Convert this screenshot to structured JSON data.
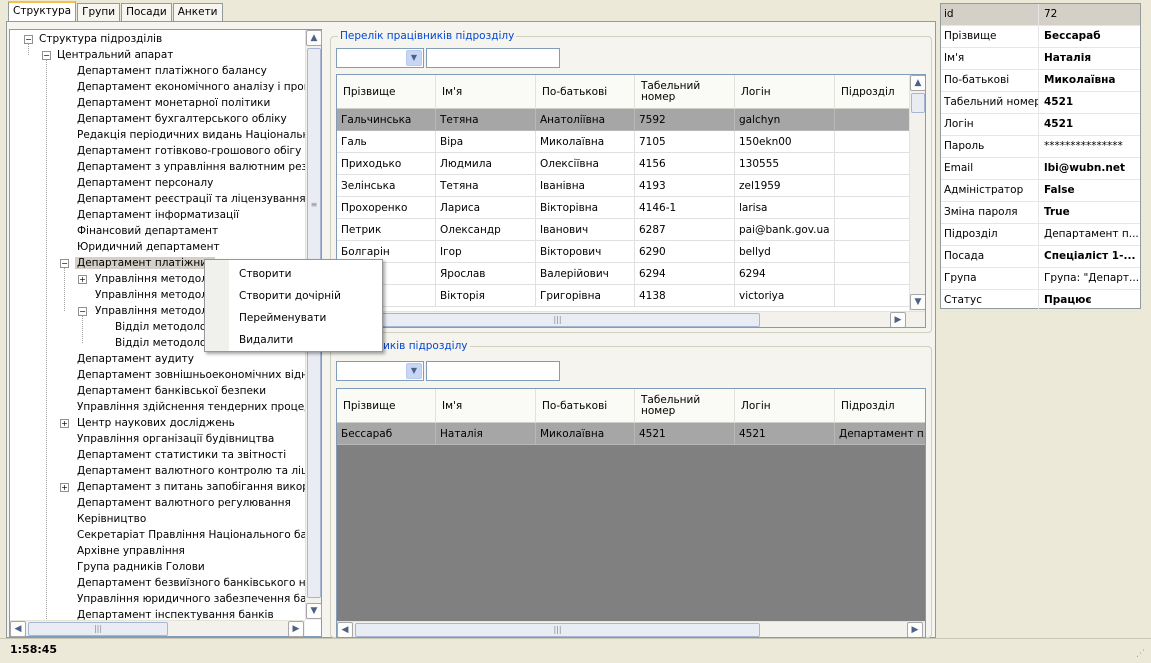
{
  "tabs": [
    "Структура",
    "Групи",
    "Посади",
    "Анкети"
  ],
  "tree": {
    "root": "Структура підрозділів",
    "items": [
      {
        "label": "Центральний апарат",
        "level": 1,
        "exp": "-"
      },
      {
        "label": "Департамент платіжного балансу",
        "level": 2
      },
      {
        "label": "Департамент економічного аналізу і прогноз",
        "level": 2
      },
      {
        "label": "Департамент монетарної політики",
        "level": 2
      },
      {
        "label": "Департамент бухгалтерського обліку",
        "level": 2
      },
      {
        "label": "Редакція періодичних видань Національного",
        "level": 2
      },
      {
        "label": "Департамент готівково-грошового обігу",
        "level": 2
      },
      {
        "label": "Департамент з управління валютним резерв",
        "level": 2
      },
      {
        "label": "Департамент персоналу",
        "level": 2
      },
      {
        "label": "Департамент реєстрації та ліцензування бан",
        "level": 2
      },
      {
        "label": "Департамент інформатизації",
        "level": 2
      },
      {
        "label": "Фінансовий департамент",
        "level": 2
      },
      {
        "label": "Юридичний департамент",
        "level": 2
      },
      {
        "label": "Департамент платіжних",
        "level": 2,
        "exp": "-",
        "sel": true
      },
      {
        "label": "Управління методол",
        "level": 3,
        "exp": "+"
      },
      {
        "label": "Управління методол",
        "level": 3
      },
      {
        "label": "Управління методол",
        "level": 3,
        "exp": "-"
      },
      {
        "label": "Відділ методолог",
        "level": 4
      },
      {
        "label": "Відділ методолог",
        "level": 4
      },
      {
        "label": "Департамент аудиту",
        "level": 2
      },
      {
        "label": "Департамент зовнішньоекономічних відносин",
        "level": 2
      },
      {
        "label": "Департамент банківської безпеки",
        "level": 2
      },
      {
        "label": "Управління здійснення тендерних процедур т",
        "level": 2
      },
      {
        "label": "Центр наукових досліджень",
        "level": 2,
        "exp": "+"
      },
      {
        "label": "Управління організації будівництва",
        "level": 2
      },
      {
        "label": "Департамент статистики та звітності",
        "level": 2
      },
      {
        "label": "Департамент валютного контролю та ліцензу",
        "level": 2
      },
      {
        "label": "Департамент з питань запобігання використ",
        "level": 2,
        "exp": "+"
      },
      {
        "label": "Департамент валютного регулювання",
        "level": 2
      },
      {
        "label": "Керівництво",
        "level": 2
      },
      {
        "label": "Секретаріат Правління Національного банку",
        "level": 2
      },
      {
        "label": "Архівне управління",
        "level": 2
      },
      {
        "label": "Група радників Голови",
        "level": 2
      },
      {
        "label": "Департамент безвиїзного банківського нагл",
        "level": 2
      },
      {
        "label": "Управління юридичного забезпечення банків",
        "level": 2
      },
      {
        "label": "Департамент інспектування банків",
        "level": 2
      }
    ]
  },
  "context_menu": [
    "Створити",
    "Створити дочірній",
    "Перейменувати",
    "Видалити"
  ],
  "top_group": {
    "title": "Перелік працівників підрозділу",
    "columns": [
      "Прізвище",
      "Ім'я",
      "По-батькові",
      "Табельний номер",
      "Логін",
      "Підрозділ"
    ],
    "rows": [
      [
        "Гальчинська",
        "Тетяна",
        "Анатоліївна",
        "7592",
        "galchyn",
        ""
      ],
      [
        "Галь",
        "Віра",
        "Миколаївна",
        "7105",
        "150ekn00",
        ""
      ],
      [
        "Приходько",
        "Людмила",
        "Олексіївна",
        "4156",
        "130555",
        ""
      ],
      [
        "Зелінська",
        "Тетяна",
        "Іванівна",
        "4193",
        "zel1959",
        ""
      ],
      [
        "Прохоренко",
        "Лариса",
        "Вікторівна",
        "4146-1",
        "larisa",
        ""
      ],
      [
        "Петрик",
        "Олександр",
        "Іванович",
        "6287",
        "pai@bank.gov.ua",
        ""
      ],
      [
        "Болгарін",
        "Ігор",
        "Вікторович",
        "6290",
        "bellyd",
        ""
      ],
      [
        "к",
        "Ярослав",
        "Валерійович",
        "6294",
        "6294",
        ""
      ],
      [
        "",
        "Вікторія",
        "Григорівна",
        "4138",
        "victoriya",
        ""
      ]
    ]
  },
  "bottom_group": {
    "title": "працівників підрозділу",
    "columns": [
      "Прізвище",
      "Ім'я",
      "По-батькові",
      "Табельний номер",
      "Логін",
      "Підрозділ"
    ],
    "rows": [
      [
        "Бессараб",
        "Наталія",
        "Миколаївна",
        "4521",
        "4521",
        "Департамент п..."
      ]
    ]
  },
  "properties": [
    {
      "k": "id",
      "v": "72",
      "bold": false
    },
    {
      "k": "Прізвище",
      "v": "Бессараб",
      "bold": true
    },
    {
      "k": "Ім'я",
      "v": "Наталія",
      "bold": true
    },
    {
      "k": "По-батькові",
      "v": "Миколаївна",
      "bold": true
    },
    {
      "k": "Табельний номер",
      "v": "4521",
      "bold": true
    },
    {
      "k": "Логін",
      "v": "4521",
      "bold": true
    },
    {
      "k": "Пароль",
      "v": "***************",
      "bold": false
    },
    {
      "k": "Email",
      "v": "lbi@wubn.net",
      "bold": true
    },
    {
      "k": "Адміністратор",
      "v": "False",
      "bold": true
    },
    {
      "k": "Зміна пароля",
      "v": "True",
      "bold": true
    },
    {
      "k": "Підрозділ",
      "v": "Департамент п...",
      "bold": false
    },
    {
      "k": "Посада",
      "v": "Спеціаліст 1-...",
      "bold": true
    },
    {
      "k": "Група",
      "v": "Група: \"Департ...",
      "bold": false
    },
    {
      "k": "Статус",
      "v": "Працює",
      "bold": true
    }
  ],
  "status": {
    "clock": "1:58:45"
  }
}
